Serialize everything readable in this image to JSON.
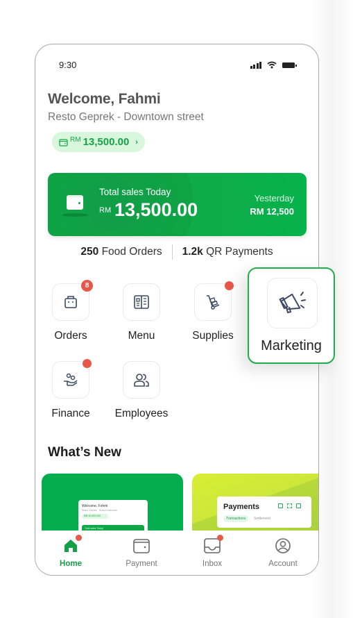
{
  "status_bar": {
    "time": "9:30",
    "icons": [
      "signal-icon",
      "wifi-icon",
      "battery-icon"
    ]
  },
  "header": {
    "welcome": "Welcome, Fahmi",
    "store": "Resto Geprek - Downtown street",
    "balance": {
      "currency": "RM",
      "amount": "13,500.00",
      "chevron": "›"
    }
  },
  "sales_card": {
    "label": "Total sales Today",
    "currency": "RM",
    "amount": "13,500.00",
    "yesterday_label": "Yesterday",
    "yesterday_value": "RM 12,500"
  },
  "stats": {
    "food_orders_count": "250",
    "food_orders_label": "Food Orders",
    "qr_count": "1.2k",
    "qr_label": "QR Payments"
  },
  "menu": {
    "items": [
      {
        "label": "Orders",
        "icon": "bag-icon",
        "badge": "8"
      },
      {
        "label": "Menu",
        "icon": "menu-book-icon",
        "badge": null
      },
      {
        "label": "Supplies",
        "icon": "trolley-icon",
        "dot": true
      },
      {
        "label": "Finance",
        "icon": "finance-hand-icon",
        "dot": true
      },
      {
        "label": "Employees",
        "icon": "people-icon",
        "badge": null
      }
    ],
    "highlight": {
      "label": "Marketing",
      "icon": "megaphone-icon"
    }
  },
  "whats_new": {
    "title": "What’s New",
    "promo1": {
      "mini_title": "Welcome, Fohmi",
      "mini_sub": "Resto Geprek · Grand Indonesia",
      "mini_pill": "RM 10.000.000",
      "mini_card": "Total sales Today"
    },
    "promo2": {
      "title": "Payments",
      "tab_active": "Transactions",
      "tab_other": "Settlement"
    }
  },
  "bottom_nav": {
    "items": [
      {
        "label": "Home",
        "active": true,
        "dot": true
      },
      {
        "label": "Payment",
        "active": false,
        "dot": false
      },
      {
        "label": "Inbox",
        "active": false,
        "dot": true
      },
      {
        "label": "Account",
        "active": false,
        "dot": false
      }
    ]
  },
  "colors": {
    "brand_green": "#04ad4d",
    "badge_red": "#e8584a",
    "pill_bg": "#d9f7dc",
    "icon_navy": "#3d4a63"
  }
}
